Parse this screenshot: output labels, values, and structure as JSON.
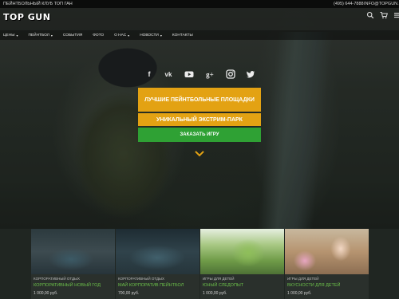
{
  "topbar": {
    "club_name": "ПЕЙНТБОЛЬНЫЙ КЛУБ ТОП ГАН",
    "phone": "(495) 644-7888",
    "email": "INFO@TOPGUN.RU"
  },
  "header": {
    "logo": "TOP GUN",
    "icons": [
      "search-icon",
      "cart-icon",
      "menu-icon"
    ]
  },
  "nav": {
    "items": [
      {
        "label": "ЦЕНЫ",
        "dropdown": true
      },
      {
        "label": "ПЕЙНТБОЛ",
        "dropdown": true
      },
      {
        "label": "СОБЫТИЯ",
        "dropdown": false
      },
      {
        "label": "ФОТО",
        "dropdown": false
      },
      {
        "label": "О НАС",
        "dropdown": true
      },
      {
        "label": "НОВОСТИ",
        "dropdown": true
      },
      {
        "label": "КОНТАКТЫ",
        "dropdown": false
      }
    ]
  },
  "social": [
    "facebook-icon",
    "vk-icon",
    "youtube-icon",
    "google-plus-icon",
    "instagram-icon",
    "twitter-icon"
  ],
  "hero": {
    "cta_best_venues": "ЛУЧШИЕ ПЕЙНТБОЛЬНЫЕ ПЛОЩАДКИ",
    "cta_extreme_park": "УНИКАЛЬНЫЙ ЭКСТРИМ-ПАРК",
    "cta_order_game": "ЗАКАЗАТЬ ИГРУ"
  },
  "cards": [
    {
      "category": "КОРПОРАТИВНЫЙ ОТДЫХ",
      "title": "КОРПОРАТИВНЫЙ НОВЫЙ ГОД",
      "price": "1 000,00 руб."
    },
    {
      "category": "КОРПОРАТИВНЫЙ ОТДЫХ",
      "title": "МАЙ КОРПОРАТИВ ПЕЙНТБОЛ",
      "price": "700,00 руб."
    },
    {
      "category": "ИГРЫ ДЛЯ ДЕТЕЙ",
      "title": "ЮНЫЙ СЛЕДОПЫТ",
      "price": "1 000,00 руб."
    },
    {
      "category": "ИГРЫ ДЛЯ ДЕТЕЙ",
      "title": "ВКУСНОСТИ ДЛЯ ДЕТЕЙ",
      "price": "1 000,00 руб."
    }
  ],
  "colors": {
    "accent_orange": "#e3a213",
    "accent_green": "#2fa134",
    "card_title_green": "#6cc04a"
  }
}
